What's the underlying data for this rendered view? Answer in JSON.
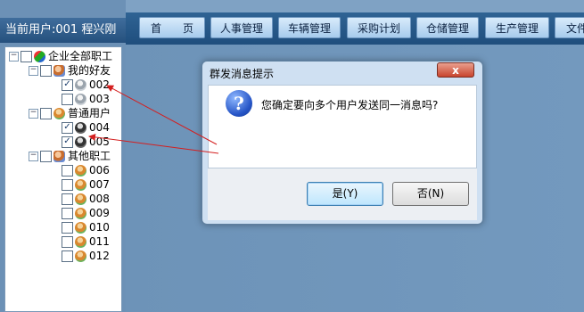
{
  "sidebar": {
    "current_user": "当前用户:001 程兴刚",
    "tree": {
      "root": "企业全部职工",
      "groups": [
        {
          "label": "我的好友",
          "icon": "group-icon",
          "members": [
            {
              "label": "002",
              "checked": true,
              "icon": "gray-user-icon"
            },
            {
              "label": "003",
              "checked": false,
              "icon": "gray-user-icon"
            }
          ]
        },
        {
          "label": "普通用户",
          "icon": "user-icon",
          "members": [
            {
              "label": "004",
              "checked": true,
              "icon": "dark-user-icon"
            },
            {
              "label": "005",
              "checked": true,
              "icon": "dark-user-icon"
            }
          ]
        },
        {
          "label": "其他职工",
          "icon": "group-icon",
          "members": [
            {
              "label": "006",
              "checked": false,
              "icon": "user-icon"
            },
            {
              "label": "007",
              "checked": false,
              "icon": "user-icon"
            },
            {
              "label": "008",
              "checked": false,
              "icon": "user-icon"
            },
            {
              "label": "009",
              "checked": false,
              "icon": "user-icon"
            },
            {
              "label": "010",
              "checked": false,
              "icon": "user-icon"
            },
            {
              "label": "011",
              "checked": false,
              "icon": "user-icon"
            },
            {
              "label": "012",
              "checked": false,
              "icon": "user-icon"
            }
          ]
        }
      ]
    }
  },
  "nav": {
    "items": [
      "首　　页",
      "人事管理",
      "车辆管理",
      "采购计划",
      "仓储管理",
      "生产管理",
      "文件"
    ]
  },
  "dialog": {
    "title": "群发消息提示",
    "close": "x",
    "message": "您确定要向多个用户发送同一消息吗?",
    "icon": "question-icon",
    "yes_label": "是(Y)",
    "no_label": "否(N)"
  },
  "colors": {
    "background": "#6f94b8",
    "nav_bar": "#1f4e7d",
    "arrow": "#d41f1f"
  }
}
